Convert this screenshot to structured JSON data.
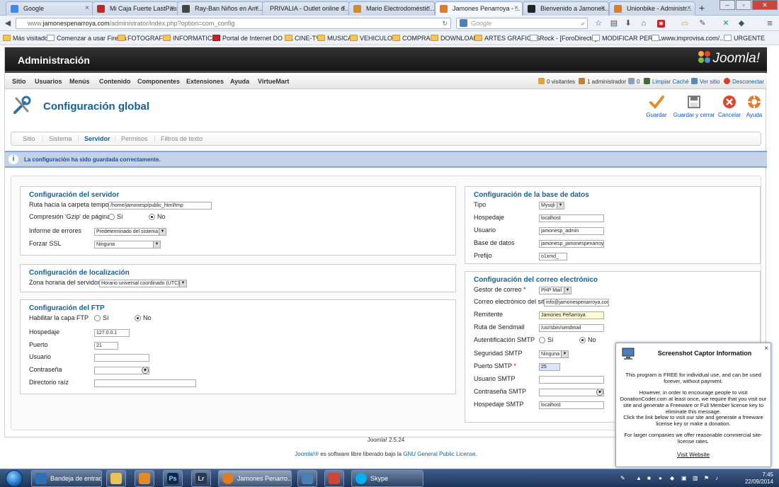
{
  "browser": {
    "tabs": [
      {
        "label": "Google",
        "color": "#4285f4"
      },
      {
        "label": "Mi Caja Fuerte LastPass",
        "color": "#c0272d"
      },
      {
        "label": "Ray-Ban Niños en Am...",
        "color": "#444444"
      },
      {
        "label": "PRIVALIA - Outlet online d...",
        "color": "#ffffff"
      },
      {
        "label": "Mario Electrodoméstic...",
        "color": "#d28a2c"
      },
      {
        "label": "Jamones Penarroya - ...",
        "color": "#e07b24"
      },
      {
        "label": "Bienvenido a Jamones...",
        "color": "#222222"
      },
      {
        "label": "Unionbike - Administr...",
        "color": "#e07b24"
      }
    ],
    "url_prefix": "www.",
    "url_domain": "jamonespenarroya.com",
    "url_path": "/administrator/index.php?option=com_config",
    "search_placeholder": "Google",
    "bookmarks": [
      {
        "label": "Más visitados",
        "icon": "folder"
      },
      {
        "label": "Comenzar a usar Firefox",
        "icon": "page"
      },
      {
        "label": "FOTOGRAFIA",
        "icon": "folder"
      },
      {
        "label": "INFORMATICA",
        "icon": "folder"
      },
      {
        "label": "Portal de Internet DO S...",
        "icon": "red"
      },
      {
        "label": "CINE-TV",
        "icon": "folder"
      },
      {
        "label": "MUSICA",
        "icon": "folder"
      },
      {
        "label": "VEHICULOS",
        "icon": "folder"
      },
      {
        "label": "COMPRAS",
        "icon": "folder"
      },
      {
        "label": "DOWNLOAD",
        "icon": "folder"
      },
      {
        "label": "ARTES GRAFICAS",
        "icon": "folder"
      },
      {
        "label": "Rock - [ForoDirecto]",
        "icon": "page"
      },
      {
        "label": "MODIFICAR PERFIL",
        "icon": "page"
      },
      {
        "label": "www.improvisa.com/...",
        "icon": "page"
      },
      {
        "label": "URGENTE",
        "icon": "page"
      }
    ]
  },
  "admin": {
    "header_title": "Administración",
    "logo_text": "Joomla!",
    "menu": [
      "Sitio",
      "Usuarios",
      "Menús",
      "Contenido",
      "Componentes",
      "Extensiones",
      "Ayuda",
      "VirtueMart"
    ],
    "status": {
      "visitors": "0 visitantes",
      "admins": "1 administrador",
      "messages": "0",
      "clear_cache": "Limpiar Caché",
      "view_site": "Ver sitio",
      "logout": "Desconectar"
    },
    "page_title": "Configuración global",
    "toolbar": {
      "save": "Guardar",
      "save_close": "Guardar y cerrar",
      "cancel": "Cancelar",
      "help": "Ayuda"
    },
    "subtabs": [
      "Sitio",
      "Sistema",
      "Servidor",
      "Permisos",
      "Filtros de texto"
    ],
    "active_subtab": "Servidor",
    "message": "La configuración ha sido guardada correctamente.",
    "server": {
      "legend": "Configuración del servidor",
      "tmp_path_label": "Ruta hacia la carpeta temporal",
      "tmp_path_value": "/home/jamonesp/public_html/tmp",
      "gzip_label": "Compresión 'Gzip' de páginas",
      "yes": "Sí",
      "no": "No",
      "errors_label": "Informe de errores",
      "errors_value": "Predeterminado del sistema",
      "ssl_label": "Forzar SSL",
      "ssl_value": "Ninguna"
    },
    "locale": {
      "legend": "Configuración de localización",
      "tz_label": "Zona horaria del servidor",
      "tz_value": "Horario universal coordinado (UTC)"
    },
    "ftp": {
      "legend": "Configuración del FTP",
      "enable_label": "Habilitar la capa FTP",
      "host_label": "Hospedaje",
      "host_value": "127.0.0.1",
      "port_label": "Puerto",
      "port_value": "21",
      "user_label": "Usuario",
      "pass_label": "Contraseña",
      "root_label": "Directorio raíz"
    },
    "db": {
      "legend": "Configuración de la base de datos",
      "type_label": "Tipo",
      "type_value": "Mysqli",
      "host_label": "Hospedaje",
      "host_value": "localhost",
      "user_label": "Usuario",
      "user_value": "jamonesp_admin",
      "name_label": "Base de datos",
      "name_value": "jamonesp_jamonespenarroya",
      "prefix_label": "Prefijo",
      "prefix_value": "o1xmd_"
    },
    "mail": {
      "legend": "Configuración del correo electrónico",
      "mailer_label": "Gestor de correo",
      "mailer_value": "PHP Mail",
      "from_email_label": "Correo electrónico del sitio",
      "from_email_value": "info@jamonespenarroya.com",
      "from_name_label": "Remitente",
      "from_name_value": "Jamones Peñarroya",
      "sendmail_label": "Ruta de Sendmail",
      "sendmail_value": "/usr/sbin/sendmail",
      "smtp_auth_label": "Autentificación SMTP",
      "smtp_secure_label": "Seguridad SMTP",
      "smtp_secure_value": "Ninguna",
      "smtp_port_label": "Puerto SMTP",
      "smtp_port_value": "25",
      "smtp_user_label": "Usuario SMTP",
      "smtp_pass_label": "Contraseña SMTP",
      "smtp_host_label": "Hospedaje SMTP",
      "smtp_host_value": "localhost"
    },
    "footer_version": "Joomla! 2.5.24",
    "footer_link1": "Joomla!®",
    "footer_mid": " es software libre liberado bajo la ",
    "footer_link2": "GNU General Public License."
  },
  "popup": {
    "title": "Screenshot Captor Information",
    "p1": "This program is FREE for individual use, and can be used forever, without payment.",
    "p2": "However, in order to encourage people to visit DonationCoder.com at least once, we require that you visit our site and generate a Freeware or Full Member license key to eliminate this message.",
    "p3": "Click the link below to visit our site and generate a freeware license key or make a donation.",
    "p4": "For larger companies we offer reasonable commercial site-license rates.",
    "link": "Visit Website"
  },
  "taskbar": {
    "items": [
      {
        "label": "Bandeja de entrad...",
        "color": "#2f6fb3"
      },
      {
        "label": "",
        "color": "#e8c35a"
      },
      {
        "label": "",
        "color": "#e08a2c"
      },
      {
        "label": "Ps",
        "color": "#0e2a4a"
      },
      {
        "label": "Lr",
        "color": "#2b3a4a"
      },
      {
        "label": "Jamones Penarro...",
        "color": "#e07b24"
      },
      {
        "label": "",
        "color": "#4c7fb5"
      },
      {
        "label": "",
        "color": "#d04535"
      },
      {
        "label": "Skype",
        "color": "#00aff0"
      }
    ],
    "time": "7:45",
    "date": "22/09/2014"
  }
}
